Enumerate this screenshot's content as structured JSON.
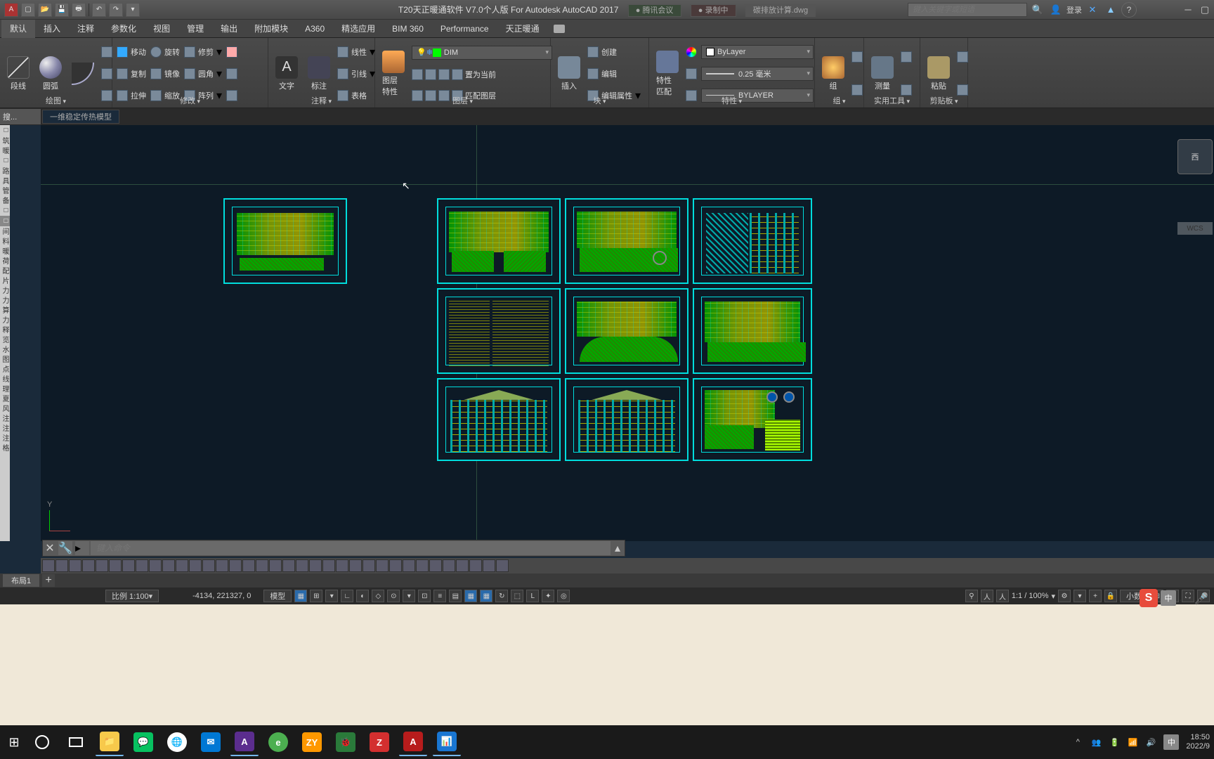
{
  "title": "T20天正暖通软件 V7.0个人版 For Autodesk AutoCAD 2017",
  "doc_name": "碳排放计算.dwg",
  "meeting_pill": "腾讯会议",
  "recording_pill": "录制中",
  "search_placeholder": "键入关键字或短语",
  "login_text": "登录",
  "menu": [
    "默认",
    "插入",
    "注释",
    "参数化",
    "视图",
    "管理",
    "输出",
    "附加模块",
    "A360",
    "精选应用",
    "BIM 360",
    "Performance",
    "天正暖通"
  ],
  "ribbon": {
    "draw": {
      "label": "绘图",
      "polyline": "段线",
      "circle": "圆弧"
    },
    "modify": {
      "label": "修改",
      "move": "移动",
      "rotate": "旋转",
      "trim": "修剪",
      "copy": "复制",
      "mirror": "镜像",
      "fillet": "圆角",
      "stretch": "拉伸",
      "scale": "缩放",
      "array": "阵列"
    },
    "annot": {
      "label": "注释",
      "text": "文字",
      "dim": "标注",
      "linear": "线性",
      "leader": "引线",
      "table": "表格"
    },
    "layer": {
      "label": "图层",
      "props": "图层特性",
      "current": "置为当前",
      "match": "匹配图层",
      "dd_value": "DIM"
    },
    "block": {
      "label": "块",
      "insert": "插入",
      "create": "创建",
      "edit": "编辑",
      "editattr": "编辑属性"
    },
    "props": {
      "label": "特性",
      "match": "特性匹配",
      "layer": "ByLayer",
      "lw": "0.25 毫米",
      "lt": "BYLAYER"
    },
    "group": {
      "label": "组",
      "group": "组"
    },
    "utils": {
      "label": "实用工具",
      "measure": "测量"
    },
    "clip": {
      "label": "剪贴板",
      "paste": "粘贴"
    }
  },
  "side_label": "搜...",
  "file_tab": "一维稳定传热模型",
  "cmd_placeholder": "键入命令",
  "layout_tab": "布局1",
  "status": {
    "scale_label": "比例 1:100",
    "coords": "-4134, 221327, 0",
    "space": "模型",
    "anno": "1:1 / 100%",
    "units": "小数"
  },
  "viewcube_face": "西",
  "viewcube_wcs": "WCS",
  "taskbar": {
    "apps": [
      {
        "color": "#f7c94b",
        "txt": "📁"
      },
      {
        "color": "#07c160",
        "txt": "💬"
      },
      {
        "color": "#fff",
        "txt": "🌐"
      },
      {
        "color": "#0078d4",
        "txt": "✉"
      },
      {
        "color": "#5b2d8e",
        "txt": "A"
      },
      {
        "color": "#4caf50",
        "txt": "e"
      },
      {
        "color": "#ff9800",
        "txt": "ZY"
      },
      {
        "color": "#2a7a3a",
        "txt": "🐞"
      },
      {
        "color": "#d32f2f",
        "txt": "Z"
      },
      {
        "color": "#b71c1c",
        "txt": "A"
      },
      {
        "color": "#1976d2",
        "txt": "📊"
      }
    ],
    "ime": "中",
    "sogou": "S",
    "time": "18:50",
    "date": "2022/9"
  }
}
